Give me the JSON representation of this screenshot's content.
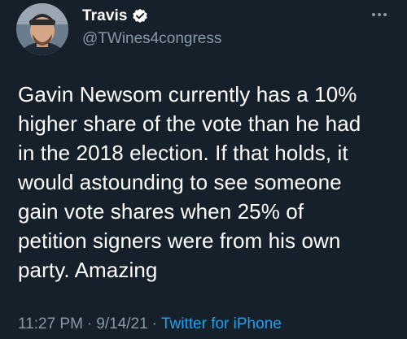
{
  "author": {
    "display_name": "Travis",
    "handle": "@TWines4congress",
    "verified": true
  },
  "tweet": {
    "text": "Gavin Newsom currently has a 10%\nhigher share of the vote than he had\nin the 2018 election.  If that holds, it\nwould astounding to see someone\ngain vote shares when 25% of\npetition signers were from his own\nparty.  Amazing",
    "time": "11:27 PM",
    "date": "9/14/21",
    "separator": "·",
    "source": "Twitter for iPhone"
  },
  "colors": {
    "background": "#15202b",
    "text_primary": "#ffffff",
    "text_secondary": "#8899a6",
    "accent": "#1da1f2"
  },
  "icons": {
    "verified": "verified-badge-icon",
    "more": "more-horizontal-icon"
  }
}
